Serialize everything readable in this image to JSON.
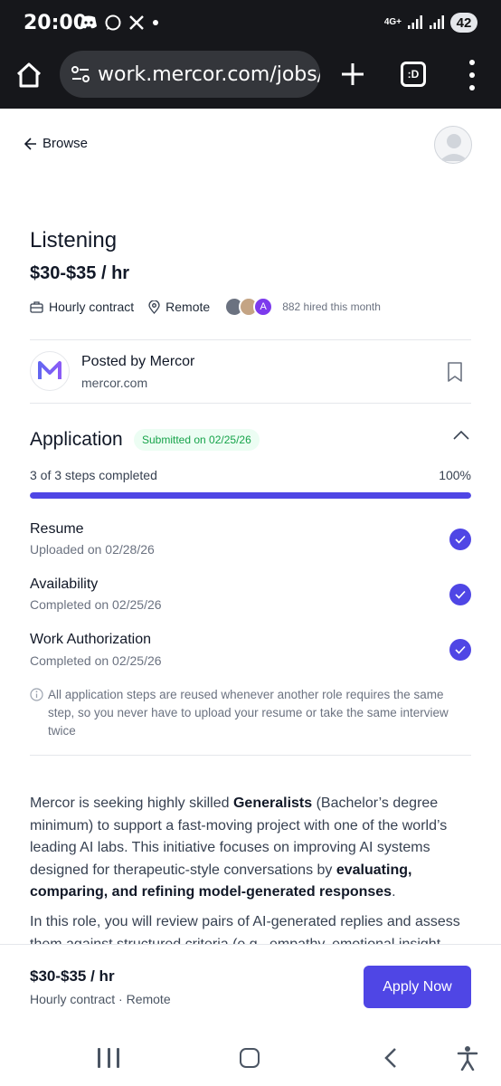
{
  "status_bar": {
    "time": "20:00",
    "network": "4G+",
    "battery": "42"
  },
  "browser": {
    "url": "work.mercor.com/jobs/lis",
    "tabs_label": ":D"
  },
  "nav": {
    "browse_label": "Browse"
  },
  "job": {
    "title": "Listening",
    "rate": "$30-$35 / hr",
    "contract_type": "Hourly contract",
    "location": "Remote",
    "hired_avatar_letter": "A",
    "hired_text": "882 hired this month"
  },
  "poster": {
    "name": "Posted by Mercor",
    "domain": "mercor.com",
    "logo_letter": "M"
  },
  "application": {
    "title": "Application",
    "badge": "Submitted on 02/25/26",
    "steps_label": "3 of 3 steps completed",
    "progress_label": "100%",
    "progress_fraction": 1.0,
    "steps": [
      {
        "title": "Resume",
        "subtitle": "Uploaded on 02/28/26"
      },
      {
        "title": "Availability",
        "subtitle": "Completed on 02/25/26"
      },
      {
        "title": "Work Authorization",
        "subtitle": "Completed on 02/25/26"
      }
    ],
    "info": "All application steps are reused whenever another role requires the same step, so you never have to upload your resume or take the same interview twice"
  },
  "description": {
    "p1_a": "Mercor is seeking highly skilled ",
    "p1_b": "Generalists",
    "p1_c": " (Bachelor’s degree minimum) to support a fast-moving project with one of the world’s leading AI labs. This initiative focuses on improving AI systems designed for therapeutic-style conversations by ",
    "p1_d": "evaluating, comparing, and refining model-generated responses",
    "p1_e": ".",
    "p2": "In this role, you will review pairs of AI-generated replies and assess them against structured criteria (e.g., empathy, emotional insight"
  },
  "footer": {
    "rate": "$30-$35 / hr",
    "meta": "Hourly contract · Remote",
    "apply_label": "Apply Now"
  },
  "colors": {
    "accent": "#4f46e5",
    "badge_bg": "#ecfdf3",
    "badge_text": "#16a34a",
    "chrome_bg": "#16171b"
  }
}
